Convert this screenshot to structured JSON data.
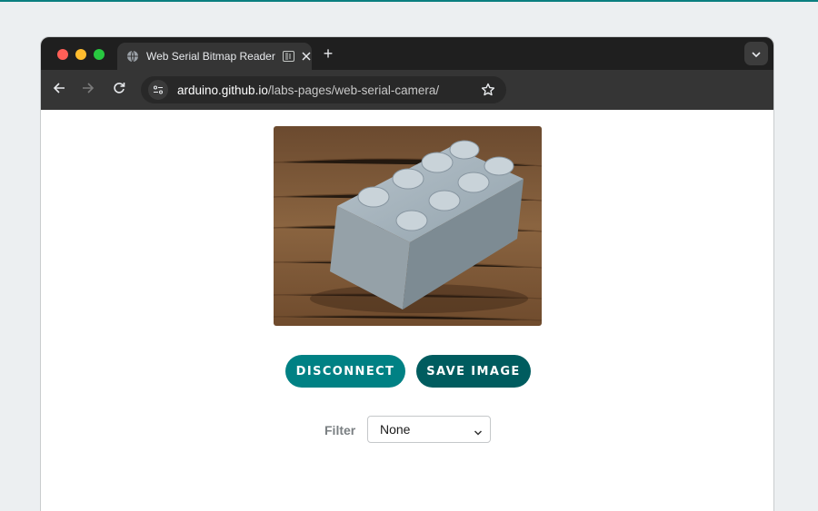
{
  "tab": {
    "title": "Web Serial Bitmap Reader",
    "favicon": "globe-icon",
    "reading_mode": "reading-mode-icon",
    "close": "close-icon",
    "new_tab": "+"
  },
  "toolbar": {
    "url_host": "arduino.github.io",
    "url_path": "/labs-pages/web-serial-camera/",
    "back": "arrow-left-icon",
    "forward": "arrow-right-icon",
    "reload": "reload-icon",
    "bookmark": "star-icon"
  },
  "camera": {
    "image": "captured-frame-lego-brick"
  },
  "controls": {
    "disconnect_label": "DISCONNECT",
    "save_label": "SAVE IMAGE",
    "filter_label": "Filter",
    "filter_value": "None"
  },
  "colors": {
    "disconnect": "#008184",
    "save": "#005c5f",
    "accent_line": "#0a7f80"
  }
}
